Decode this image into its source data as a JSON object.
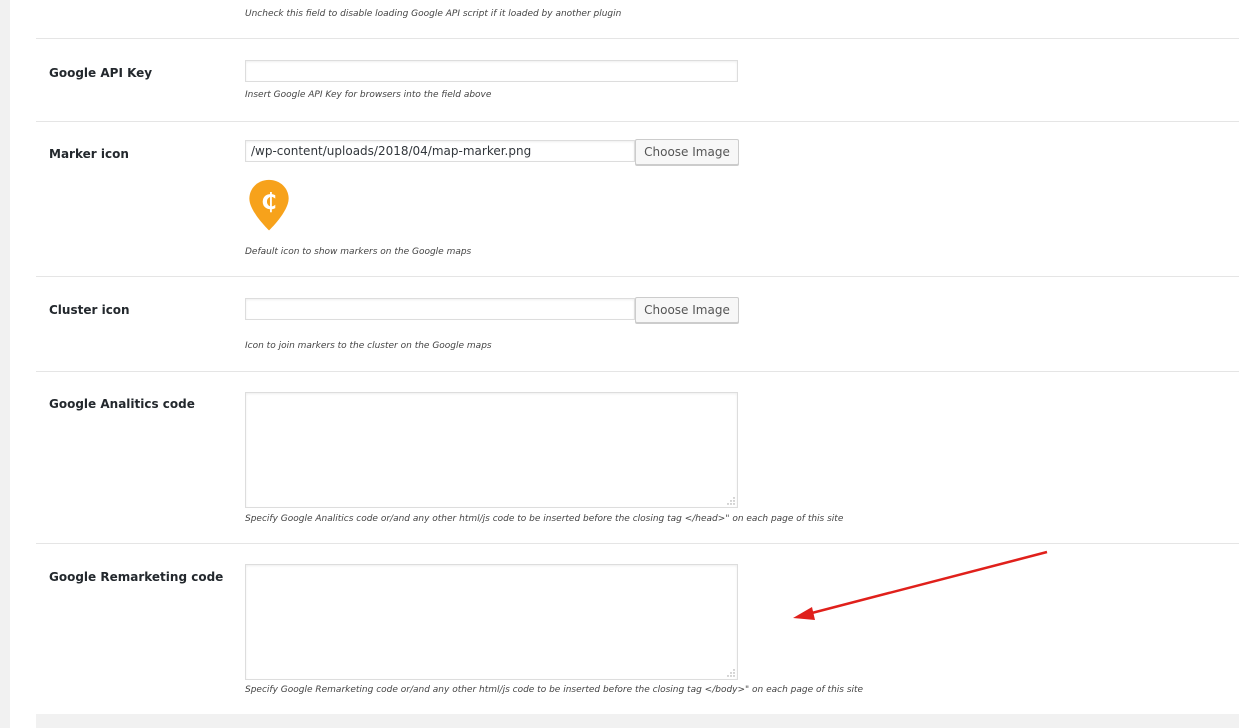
{
  "top_row": {
    "help": "Uncheck this field to disable loading Google API script if it loaded by another plugin"
  },
  "api_key": {
    "label": "Google API Key",
    "value": "",
    "help": "Insert Google API Key for browsers into the field above"
  },
  "marker_icon": {
    "label": "Marker icon",
    "value": "/wp-content/uploads/2018/04/map-marker.png",
    "button": "Choose Image",
    "help": "Default icon to show markers on the Google maps",
    "preview_color": "#f7a21b"
  },
  "cluster_icon": {
    "label": "Cluster icon",
    "value": "",
    "button": "Choose Image",
    "help": "Icon to join markers to the cluster on the Google maps"
  },
  "analytics": {
    "label": "Google Analitics code",
    "value": "",
    "help": "Specify Google Analitics code or/and any other html/js code to be inserted before the closing tag </head>\" on each page of this site"
  },
  "remarketing": {
    "label": "Google Remarketing code",
    "value": "",
    "help": "Specify Google Remarketing code or/and any other html/js code to be inserted before the closing tag </body>\" on each page of this site"
  },
  "annotation": {
    "arrow_color": "#e0201b"
  }
}
